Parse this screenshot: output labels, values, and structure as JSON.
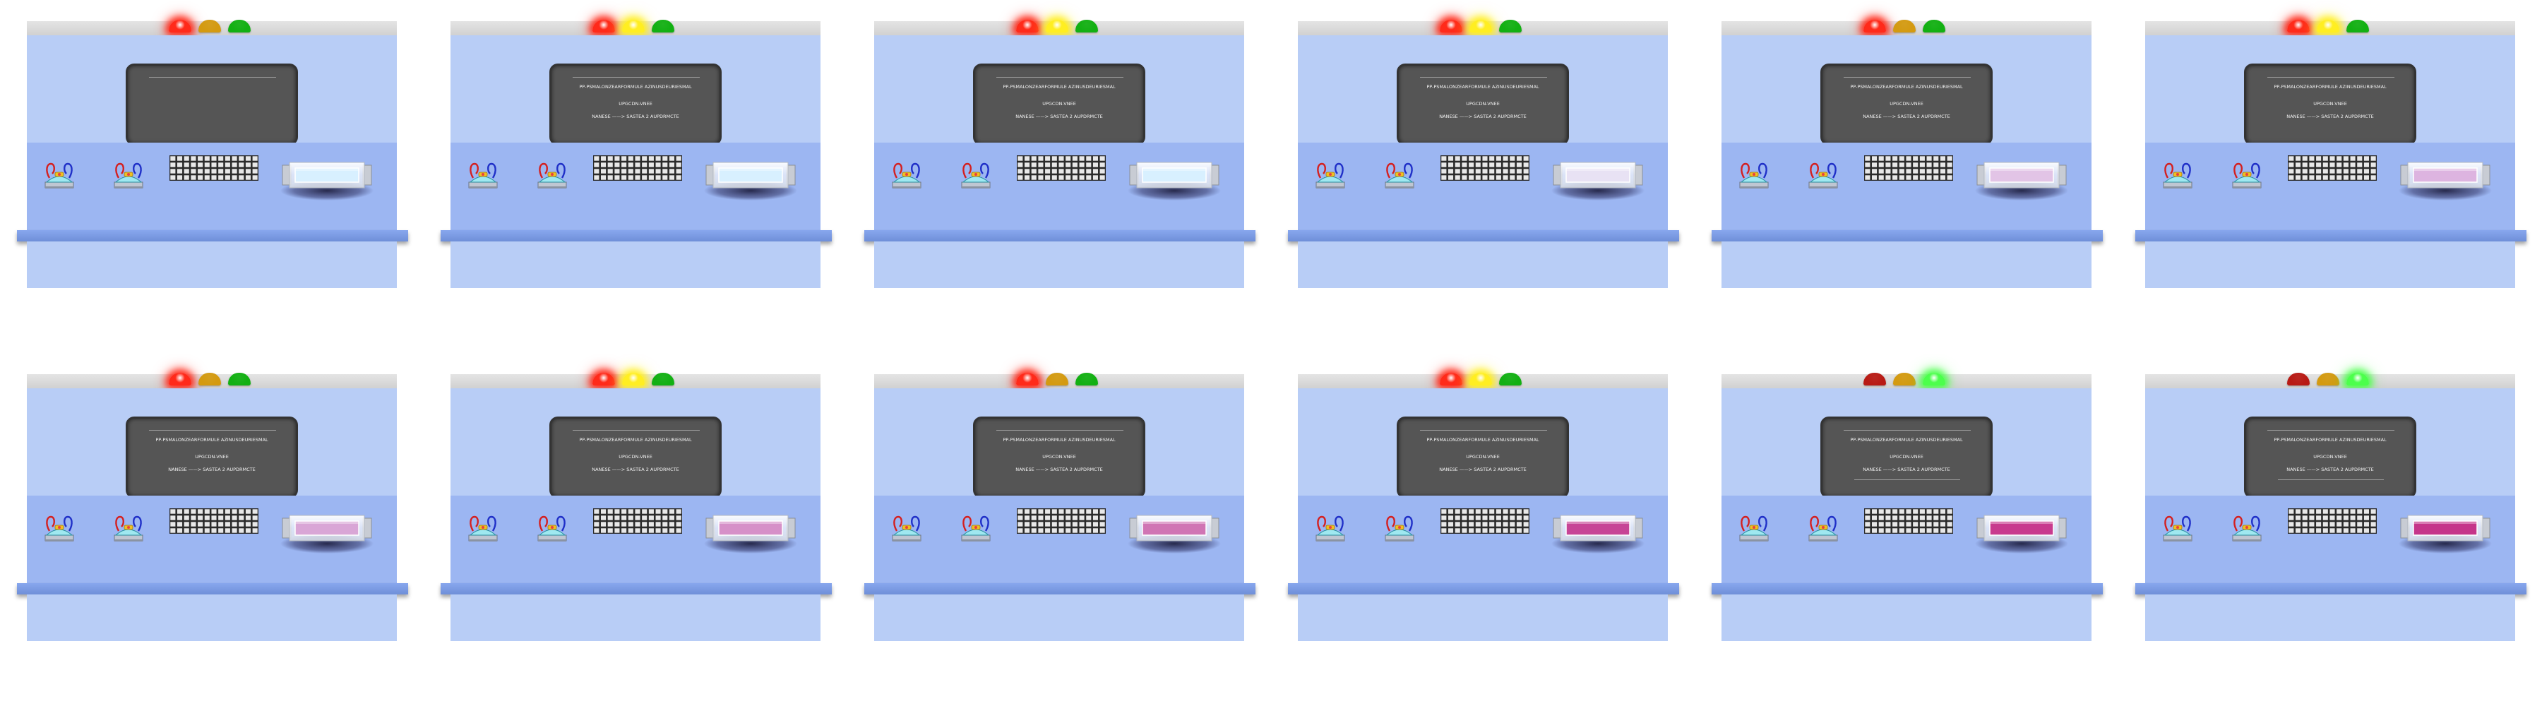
{
  "colors": {
    "body": "#b8cdf6",
    "console": "#9cb6f2",
    "screen": "#555555",
    "red_on": "#ff2a1a",
    "red_off": "#b81a14",
    "amber_on": "#ffee22",
    "amber_off": "#d49a10",
    "green_on": "#4cff4c",
    "green_off": "#12b012"
  },
  "panels": [
    {
      "lights": {
        "red": true,
        "amber": false,
        "green": false
      },
      "screen": {
        "line1": "",
        "line2": "",
        "line3": ""
      },
      "liquid": "#d8f0ff",
      "liquid_opacity": 0.0
    },
    {
      "lights": {
        "red": true,
        "amber": true,
        "green": false
      },
      "screen": {
        "line1": "PP-PSMALONZEARFORMULE AZINUSDEURIESMAL",
        "line2": "UPGCDN-VNEE",
        "line3": "NANESE ——> SASTEA 2 AUPDRMCTE"
      },
      "liquid": "#d8f0ff",
      "liquid_opacity": 0.0
    },
    {
      "lights": {
        "red": true,
        "amber": true,
        "green": false
      },
      "screen": {
        "line1": "PP-PSMALONZEARFORMULE AZINUSDEURIESMAL",
        "line2": "UPGCDN-VNEE",
        "line3": "NANESE ——> SASTEA 2 AUPDRMCTE"
      },
      "liquid": "#d8f0ff",
      "liquid_opacity": 0.0
    },
    {
      "lights": {
        "red": true,
        "amber": true,
        "green": false
      },
      "screen": {
        "line1": "PP-PSMALONZEARFORMULE AZINUSDEURIESMAL",
        "line2": "UPGCDN-VNEE",
        "line3": "NANESE ——> SASTEA 2 AUPDRMCTE"
      },
      "liquid": "#e8e2f4",
      "liquid_opacity": 0.0
    },
    {
      "lights": {
        "red": true,
        "amber": false,
        "green": false
      },
      "screen": {
        "line1": "PP-PSMALONZEARFORMULE AZINUSDEURIESMAL",
        "line2": "UPGCDN-VNEE",
        "line3": "NANESE ——> SASTEA 2 AUPDRMCTE"
      },
      "liquid": "#e2c4e6",
      "liquid_opacity": 0.0
    },
    {
      "lights": {
        "red": true,
        "amber": true,
        "green": false
      },
      "screen": {
        "line1": "PP-PSMALONZEARFORMULE AZINUSDEURIESMAL",
        "line2": "UPGCDN-VNEE",
        "line3": "NANESE ——> SASTEA 2 AUPDRMCTE"
      },
      "liquid": "#ddb4e0",
      "liquid_opacity": 0.0
    },
    {
      "lights": {
        "red": true,
        "amber": false,
        "green": false
      },
      "screen": {
        "line1": "PP-PSMALONZEARFORMULE AZINUSDEURIESMAL",
        "line2": "UPGCDN-VNEE",
        "line3": "NANESE ——> SASTEA 2 AUPDRMCTE"
      },
      "liquid": "#d9a6d6",
      "liquid_opacity": 0.0
    },
    {
      "lights": {
        "red": true,
        "amber": true,
        "green": false
      },
      "screen": {
        "line1": "PP-PSMALONZEARFORMULE AZINUSDEURIESMAL",
        "line2": "UPGCDN-VNEE",
        "line3": "NANESE ——> SASTEA 2 AUPDRMCTE"
      },
      "liquid": "#d690c8",
      "liquid_opacity": 0.0
    },
    {
      "lights": {
        "red": true,
        "amber": false,
        "green": false
      },
      "screen": {
        "line1": "PP-PSMALONZEARFORMULE AZINUSDEURIESMAL",
        "line2": "UPGCDN-VNEE",
        "line3": "NANESE ——> SASTEA 2 AUPDRMCTE"
      },
      "liquid": "#d075b4",
      "liquid_opacity": 0.0
    },
    {
      "lights": {
        "red": true,
        "amber": true,
        "green": false
      },
      "screen": {
        "line1": "PP-PSMALONZEARFORMULE AZINUSDEURIESMAL",
        "line2": "UPGCDN-VNEE",
        "line3": "NANESE ——> SASTEA 2 AUPDRMCTE"
      },
      "liquid": "#c74596",
      "liquid_opacity": 0.0
    },
    {
      "lights": {
        "red": false,
        "amber": false,
        "green": true
      },
      "screen": {
        "line1": "PP-PSMALONZEARFORMULE AZINUSDEURIESMAL",
        "line2": "UPGCDN-VNEE",
        "line3": "NANESE ——> SASTEA 2 AUPDRMCTE"
      },
      "liquid": "#c83a8e",
      "liquid_opacity": 0.0
    },
    {
      "lights": {
        "red": false,
        "amber": false,
        "green": true
      },
      "screen": {
        "line1": "PP-PSMALONZEARFORMULE AZINUSDEURIESMAL",
        "line2": "UPGCDN-VNEE",
        "line3": "NANESE ——> SASTEA 2 AUPDRMCTE"
      },
      "liquid": "#c5358a",
      "liquid_opacity": 0.0
    }
  ]
}
